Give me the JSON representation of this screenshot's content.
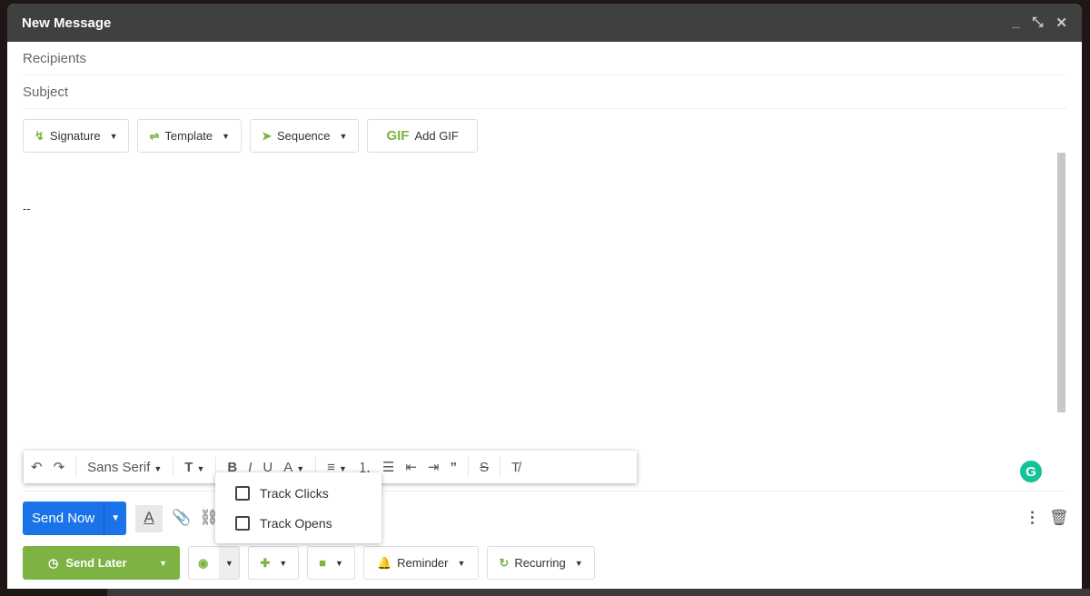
{
  "window": {
    "title": "New Message",
    "minimize": "_",
    "collapse": "⤡",
    "close": "✕"
  },
  "fields": {
    "recipients_placeholder": "Recipients",
    "subject_placeholder": "Subject"
  },
  "toolbar_top": {
    "signature": "Signature",
    "template": "Template",
    "sequence": "Sequence",
    "gif_icon": "GIF",
    "add_gif": "Add GIF"
  },
  "body": {
    "signature_text": "--"
  },
  "format": {
    "font": "Sans Serif",
    "bold": "B",
    "italic": "I",
    "underline": "U",
    "color": "A"
  },
  "tracking_menu": {
    "items": [
      "Track Clicks",
      "Track Opens"
    ]
  },
  "send": {
    "send_now": "Send Now",
    "send_later": "Send Later",
    "reminder": "Reminder",
    "recurring": "Recurring"
  },
  "colors": {
    "accent_green": "#7cb342",
    "send_blue": "#1a73e8",
    "header": "#404040"
  }
}
